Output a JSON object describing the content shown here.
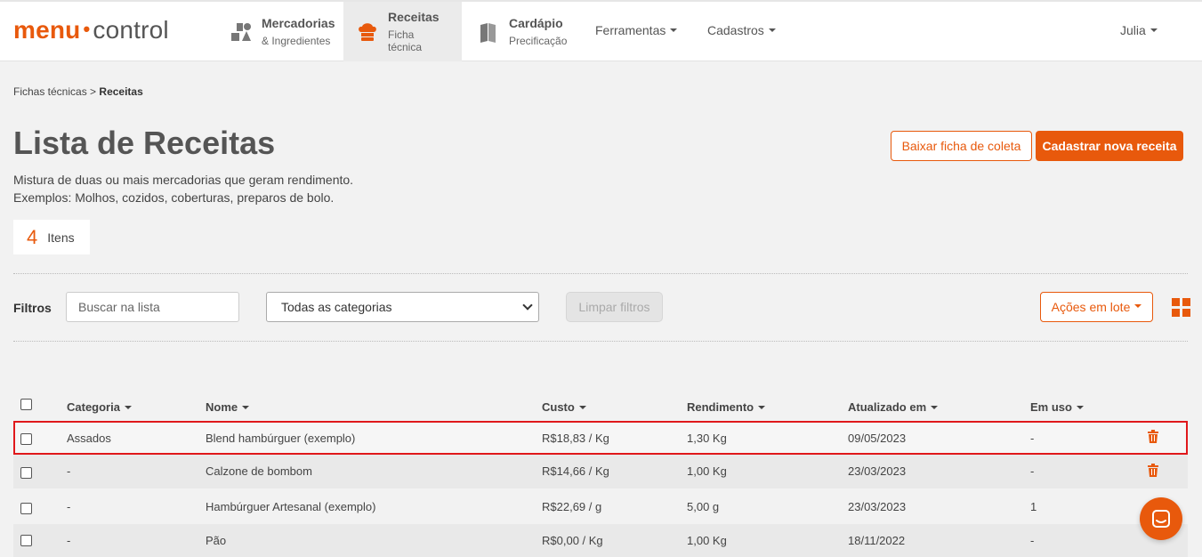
{
  "colors": {
    "accent": "#e8590c",
    "highlight_border": "#e0181b"
  },
  "logo": {
    "part1": "menu",
    "dot": "•",
    "part2": "control"
  },
  "nav": {
    "items": [
      {
        "title": "Mercadorias",
        "subtitle": "& Ingredientes",
        "icon": "ingredients-icon"
      },
      {
        "title": "Receitas",
        "subtitle": "Ficha técnica",
        "icon": "chef-hat-icon",
        "active": true
      },
      {
        "title": "Cardápio",
        "subtitle": "Precificação",
        "icon": "menu-book-icon"
      }
    ],
    "dropdowns": [
      "Ferramentas",
      "Cadastros"
    ],
    "user": "Julia"
  },
  "breadcrumb": {
    "parent": "Fichas técnicas",
    "separator": ">",
    "current": "Receitas"
  },
  "page": {
    "title": "Lista de Receitas",
    "description_line1": "Mistura de duas ou mais mercadorias que geram rendimento.",
    "description_line2": "Exemplos: Molhos, cozidos, coberturas, preparos de bolo."
  },
  "actions": {
    "download": "Baixar ficha de coleta",
    "create": "Cadastrar nova receita"
  },
  "count": {
    "number": "4",
    "label": "Itens"
  },
  "filters": {
    "label": "Filtros",
    "search_placeholder": "Buscar na lista",
    "category_selected": "Todas as categorias",
    "clear": "Limpar filtros",
    "bulk_actions": "Ações em lote"
  },
  "table": {
    "headers": [
      "Categoria",
      "Nome",
      "Custo",
      "Rendimento",
      "Atualizado em",
      "Em uso"
    ],
    "rows": [
      {
        "categoria": "Assados",
        "nome": "Blend hambúrguer (exemplo)",
        "custo": "R$18,83 / Kg",
        "rendimento": "1,30 Kg",
        "atualizado": "09/05/2023",
        "em_uso": "-"
      },
      {
        "categoria": "-",
        "nome": "Calzone de bombom",
        "custo": "R$14,66 / Kg",
        "rendimento": "1,00 Kg",
        "atualizado": "23/03/2023",
        "em_uso": "-"
      },
      {
        "categoria": "-",
        "nome": "Hambúrguer Artesanal (exemplo)",
        "custo": "R$22,69 / g",
        "rendimento": "5,00 g",
        "atualizado": "23/03/2023",
        "em_uso": "1"
      },
      {
        "categoria": "-",
        "nome": "Pão",
        "custo": "R$0,00 / Kg",
        "rendimento": "1,00 Kg",
        "atualizado": "18/11/2022",
        "em_uso": "-"
      }
    ]
  }
}
